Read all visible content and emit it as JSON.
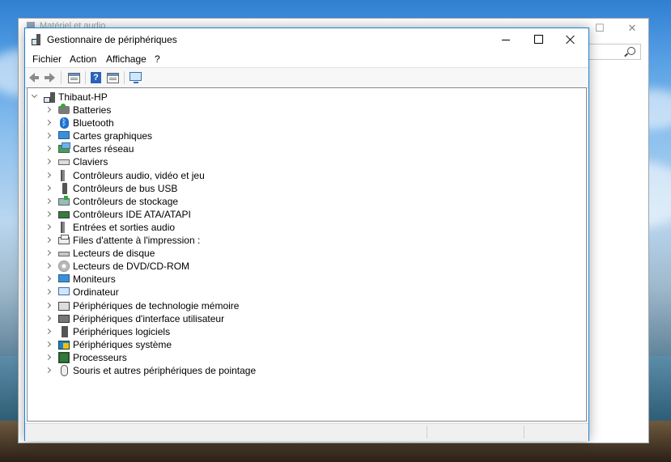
{
  "background_window": {
    "title": "Matériel et audio"
  },
  "window": {
    "title": "Gestionnaire de périphériques"
  },
  "menu": [
    "Fichier",
    "Action",
    "Affichage",
    "?"
  ],
  "toolbar": [
    "back-icon",
    "forward-icon",
    "properties-icon",
    "help-icon",
    "view-icon",
    "scan-hardware-icon"
  ],
  "tree": {
    "root": "Thibaut-HP",
    "items": [
      {
        "label": "Batteries",
        "icon": "battery-icon"
      },
      {
        "label": "Bluetooth",
        "icon": "bluetooth-icon"
      },
      {
        "label": "Cartes graphiques",
        "icon": "display-adapter-icon"
      },
      {
        "label": "Cartes réseau",
        "icon": "network-adapter-icon"
      },
      {
        "label": "Claviers",
        "icon": "keyboard-icon"
      },
      {
        "label": "Contrôleurs audio, vidéo et jeu",
        "icon": "audio-icon"
      },
      {
        "label": "Contrôleurs de bus USB",
        "icon": "usb-icon"
      },
      {
        "label": "Contrôleurs de stockage",
        "icon": "storage-controller-icon"
      },
      {
        "label": "Contrôleurs IDE ATA/ATAPI",
        "icon": "ide-controller-icon"
      },
      {
        "label": "Entrées et sorties audio",
        "icon": "audio-io-icon"
      },
      {
        "label": "Files d'attente à l'impression :",
        "icon": "printer-icon"
      },
      {
        "label": "Lecteurs de disque",
        "icon": "disk-drive-icon"
      },
      {
        "label": "Lecteurs de DVD/CD-ROM",
        "icon": "dvd-icon"
      },
      {
        "label": "Moniteurs",
        "icon": "monitor-icon"
      },
      {
        "label": "Ordinateur",
        "icon": "computer-icon"
      },
      {
        "label": "Périphériques de technologie mémoire",
        "icon": "memory-tech-icon"
      },
      {
        "label": "Périphériques d'interface utilisateur",
        "icon": "hid-icon"
      },
      {
        "label": "Périphériques logiciels",
        "icon": "software-device-icon"
      },
      {
        "label": "Périphériques système",
        "icon": "system-device-icon"
      },
      {
        "label": "Processeurs",
        "icon": "processor-icon"
      },
      {
        "label": "Souris et autres périphériques de pointage",
        "icon": "mouse-icon"
      }
    ]
  },
  "colors": {
    "accent": "#1883d7",
    "window_bg": "#ffffff",
    "chrome_bg": "#f0f0f0"
  }
}
